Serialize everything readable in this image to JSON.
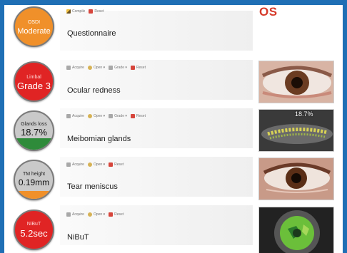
{
  "eye_side": "OS",
  "colors": {
    "orange": "#f0902a",
    "red": "#e02424",
    "grey": "#c9c9c9",
    "green": "#2e8b3a",
    "accent": "#d63a2a",
    "frame": "#1f6fb5"
  },
  "rows": [
    {
      "badge": {
        "caption": "OSDI",
        "value": "Moderate",
        "color": "#f0902a",
        "fill_fraction": 1.0
      },
      "toolbar": [
        {
          "icon": "pencil-icon",
          "label": "Compile"
        },
        {
          "icon": "reset-icon",
          "label": "Reset"
        }
      ],
      "label": "Questionnaire"
    },
    {
      "badge": {
        "caption": "Limbal",
        "value": "Grade 3",
        "color": "#e02424",
        "fill_fraction": 1.0
      },
      "toolbar": [
        {
          "icon": "camera-icon",
          "label": "Acquire"
        },
        {
          "icon": "folder-icon",
          "label": "Open"
        },
        {
          "icon": "grade-icon",
          "label": "Grade"
        },
        {
          "icon": "reset-icon",
          "label": "Reset"
        }
      ],
      "label": "Ocular redness"
    },
    {
      "badge": {
        "caption": "Glands loss",
        "value": "18.7%",
        "color": "#2e8b3a",
        "fill_fraction": 0.3
      },
      "toolbar": [
        {
          "icon": "camera-icon",
          "label": "Acquire"
        },
        {
          "icon": "folder-icon",
          "label": "Open"
        },
        {
          "icon": "grade-icon",
          "label": "Grade"
        },
        {
          "icon": "reset-icon",
          "label": "Reset"
        }
      ],
      "label": "Meibomian glands",
      "image_overlay": "18.7%"
    },
    {
      "badge": {
        "caption": "TM height",
        "value": "0.19mm",
        "color": "#f0902a",
        "fill_fraction": 0.2
      },
      "toolbar": [
        {
          "icon": "camera-icon",
          "label": "Acquire"
        },
        {
          "icon": "folder-icon",
          "label": "Open"
        },
        {
          "icon": "reset-icon",
          "label": "Reset"
        }
      ],
      "label": "Tear meniscus"
    },
    {
      "badge": {
        "caption": "NiBuT",
        "value": "5.2sec",
        "color": "#e02424",
        "fill_fraction": 1.0
      },
      "toolbar": [
        {
          "icon": "camera-icon",
          "label": "Acquire"
        },
        {
          "icon": "folder-icon",
          "label": "Open"
        },
        {
          "icon": "reset-icon",
          "label": "Reset"
        }
      ],
      "label": "NiBuT"
    }
  ]
}
